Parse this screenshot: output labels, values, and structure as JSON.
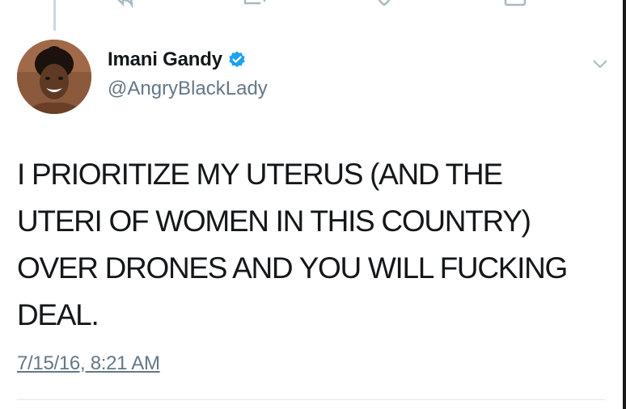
{
  "tweet": {
    "author": {
      "display_name": "Imani Gandy",
      "handle": "@AngryBlackLady",
      "verified": true,
      "verified_icon": "verified-badge-icon",
      "avatar": "profile-photo"
    },
    "text_lines": [
      "I PRIORITIZE MY UTERUS (AND THE",
      "UTERI OF WOMEN IN THIS COUNTRY)",
      "OVER DRONES AND YOU WILL FUCKING",
      "DEAL."
    ],
    "timestamp": "7/15/16, 8:21 AM",
    "menu_icon": "chevron-down-icon"
  },
  "colors": {
    "verified_blue": "#1da1f2",
    "secondary_text": "#657786",
    "primary_text": "#14171a",
    "divider": "#e1e8ed"
  }
}
